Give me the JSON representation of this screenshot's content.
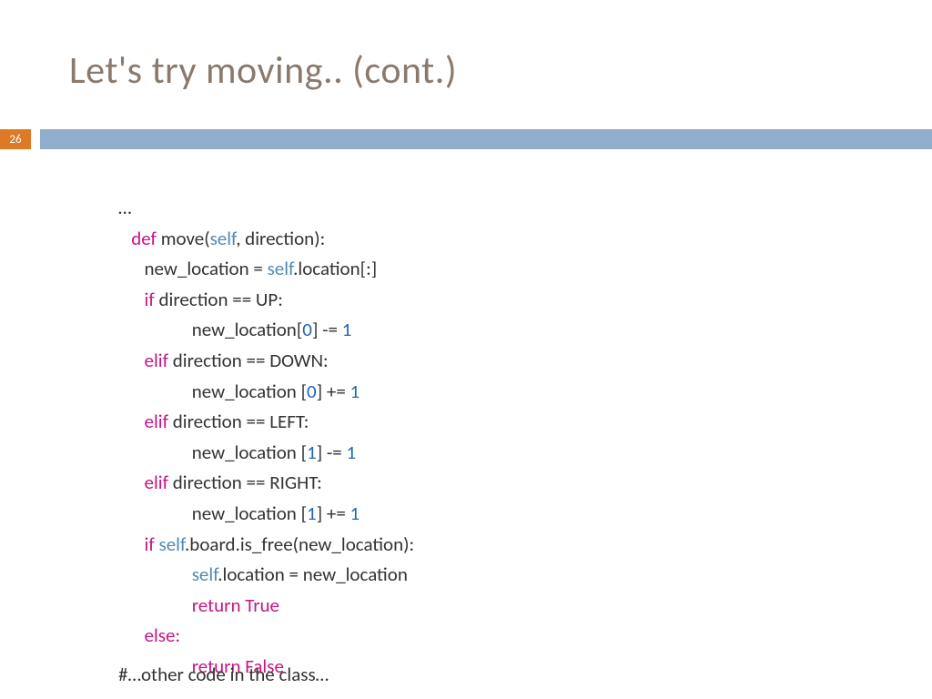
{
  "slide": {
    "title": "Let's try moving.. (cont.)",
    "page_number": "26",
    "colors": {
      "title": "#8a7a6e",
      "accent_orange": "#de7a26",
      "accent_blue": "#90aecb",
      "kw_pink": "#c71585",
      "kw_self": "#4e8ab4",
      "kw_num": "#1f66b0"
    },
    "code": {
      "ellipsis": "…",
      "def": "def ",
      "move_sig_1": "move(",
      "self": "self",
      "move_sig_2": ", direction):",
      "assign_1": "new_location = ",
      "assign_2": ".location[:]",
      "if": "if ",
      "cond_up": "direction == UP:",
      "body_up_1": "new_location[",
      "zero": "0",
      "one": "1",
      "body_up_2": "] -= ",
      "elif": "elif ",
      "cond_down": "direction == DOWN:",
      "body_down_1": "new_location [",
      "body_down_2": "] += ",
      "cond_left": "direction == LEFT:",
      "cond_right": "direction == RIGHT:",
      "if2_1": ".board.is_free(new_location):",
      "set_loc": ".location = new_location",
      "ret_true": "return True",
      "else": "else:",
      "ret_false": "return False"
    },
    "footer": "#…other code in the class…"
  }
}
